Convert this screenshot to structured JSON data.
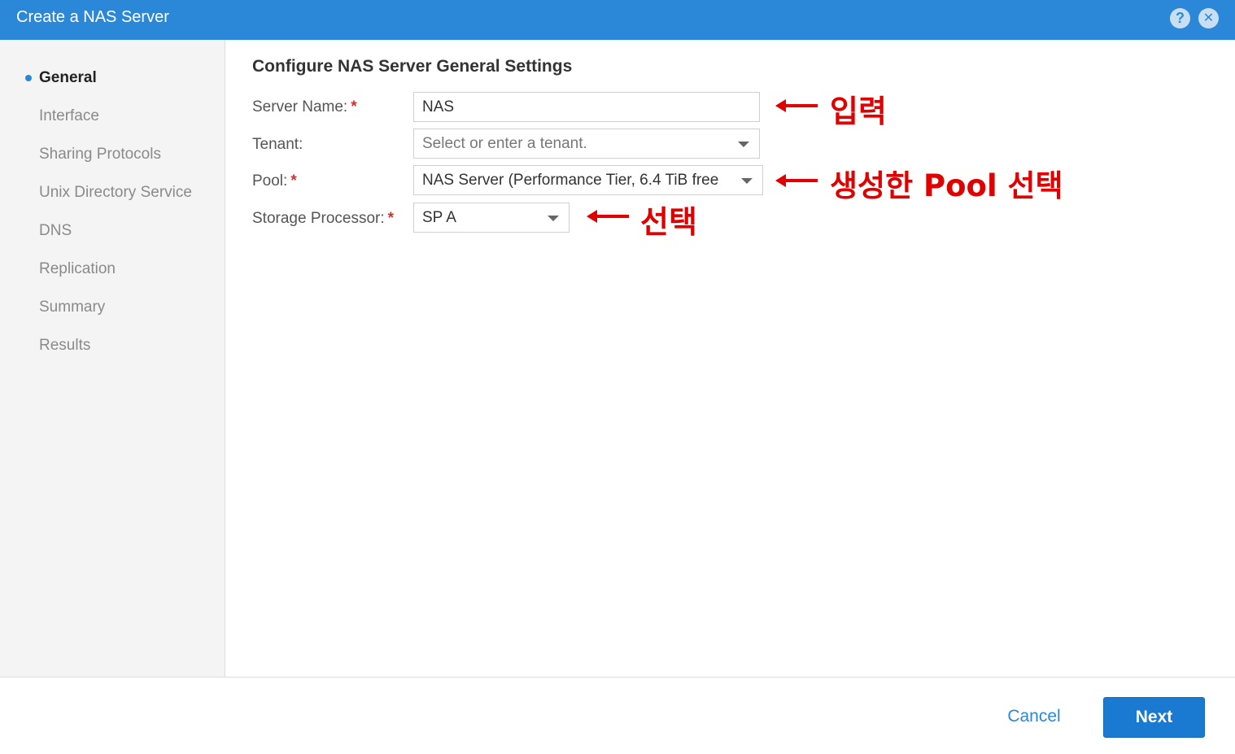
{
  "window": {
    "title": "Create a NAS Server",
    "help_icon": "?",
    "close_icon": "✕"
  },
  "sidebar": {
    "steps": [
      {
        "label": "General",
        "active": true
      },
      {
        "label": "Interface"
      },
      {
        "label": "Sharing Protocols"
      },
      {
        "label": "Unix Directory Service"
      },
      {
        "label": "DNS"
      },
      {
        "label": "Replication"
      },
      {
        "label": "Summary"
      },
      {
        "label": "Results"
      }
    ]
  },
  "main": {
    "section_title": "Configure NAS Server General Settings",
    "fields": {
      "server_name": {
        "label": "Server Name:",
        "value": "NAS"
      },
      "tenant": {
        "label": "Tenant:",
        "placeholder": "Select or enter a tenant."
      },
      "pool": {
        "label": "Pool:",
        "value": "NAS Server (Performance Tier, 6.4 TiB free"
      },
      "storage_processor": {
        "label": "Storage Processor:",
        "value": "SP A"
      }
    },
    "required_marker": "*"
  },
  "annotations": {
    "server_name": "입력",
    "pool": "생성한 Pool 선택",
    "storage_processor": "선택"
  },
  "footer": {
    "cancel_label": "Cancel",
    "next_label": "Next"
  },
  "colors": {
    "accent": "#2b88d8",
    "annotation": "#e00000",
    "required": "#d32f2f"
  }
}
